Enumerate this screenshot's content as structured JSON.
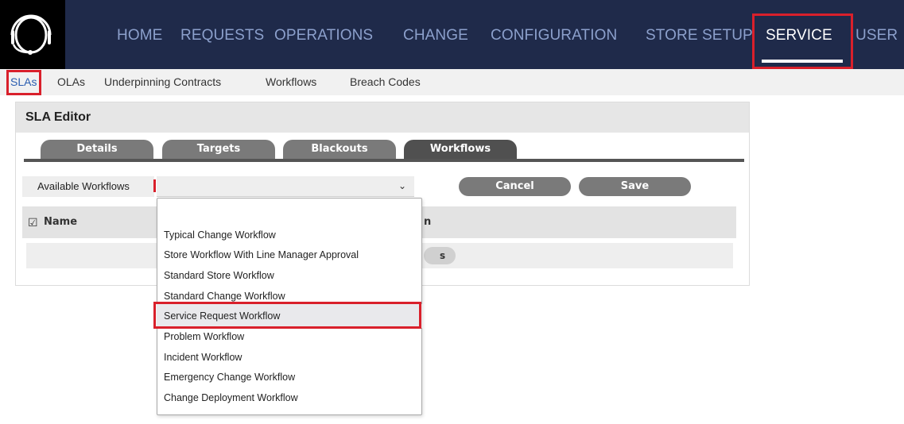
{
  "nav": {
    "items": [
      "HOME",
      "REQUESTS",
      "OPERATIONS",
      "CHANGE",
      "CONFIGURATION",
      "STORE SETUP",
      "SERVICE",
      "USER"
    ],
    "active": "SERVICE"
  },
  "subnav": {
    "items": [
      "SLAs",
      "OLAs",
      "Underpinning Contracts",
      "Workflows",
      "Breach Codes"
    ],
    "active": "SLAs"
  },
  "editor": {
    "title": "SLA Editor",
    "tabs": [
      "Details",
      "Targets",
      "Blackouts",
      "Workflows"
    ],
    "active_tab": "Workflows",
    "field_label": "Available Workflows",
    "select_value": "",
    "cancel_label": "Cancel",
    "save_label": "Save",
    "table": {
      "col_name": "Name",
      "col_partial": "n",
      "row_partial_button": "s"
    }
  },
  "dropdown": {
    "options": [
      "Typical Change Workflow",
      "Store Workflow With Line Manager Approval",
      "Standard Store Workflow",
      "Standard Change Workflow",
      "Service Request Workflow",
      "Problem Workflow",
      "Incident Workflow",
      "Emergency Change Workflow",
      "Change Deployment Workflow"
    ],
    "highlighted": "Service Request Workflow"
  },
  "colors": {
    "topbar": "#1f2a4a",
    "nav_text": "#8ca0cc",
    "highlight_box": "#d9202b",
    "tab": "#7a7a7a",
    "tab_active": "#505050"
  }
}
